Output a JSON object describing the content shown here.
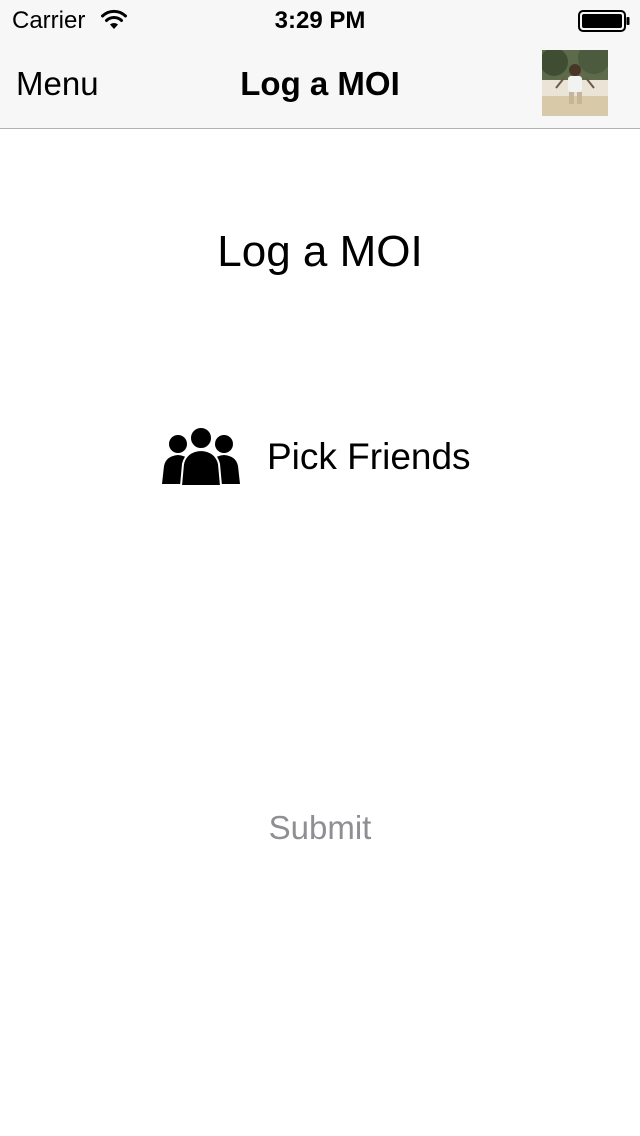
{
  "status_bar": {
    "carrier": "Carrier",
    "time": "3:29 PM",
    "icons": [
      "wifi-icon",
      "battery-icon"
    ]
  },
  "nav": {
    "menu_label": "Menu",
    "title": "Log a MOI",
    "avatar_icon": "profile-photo"
  },
  "main": {
    "heading": "Log a MOI",
    "pick_friends": {
      "label": "Pick Friends",
      "icon": "group-icon"
    },
    "submit_label": "Submit"
  },
  "colors": {
    "bar_background": "#f7f7f7",
    "divider": "#b2b2b2",
    "disabled_text": "#8e8e93"
  }
}
